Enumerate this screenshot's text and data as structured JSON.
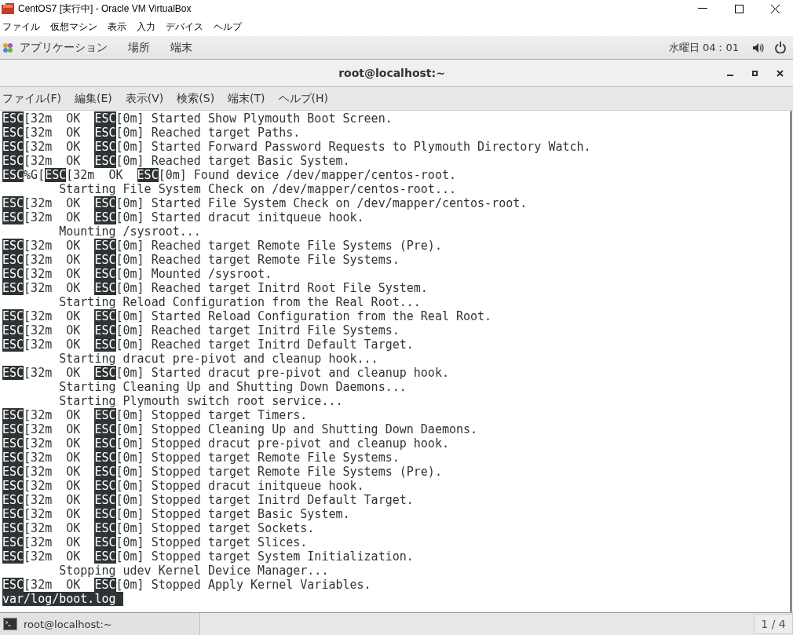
{
  "host_window": {
    "title": "CentOS7 [実行中] - Oracle VM VirtualBox"
  },
  "host_menu": [
    "ファイル",
    "仮想マシン",
    "表示",
    "入力",
    "デバイス",
    "ヘルプ"
  ],
  "top_bar": {
    "menus": [
      "アプリケーション",
      "場所",
      "端末"
    ],
    "clock": "水曜日 04：01"
  },
  "terminal": {
    "title": "root@localhost:~",
    "menu": [
      "ファイル(F)",
      "編集(E)",
      "表示(V)",
      "検索(S)",
      "端末(T)",
      "ヘルプ(H)"
    ],
    "lines": [
      [
        {
          "kind": "inverse",
          "text": "ESC"
        },
        {
          "kind": "plain",
          "text": "[32m  OK  "
        },
        {
          "kind": "inverse",
          "text": "ESC"
        },
        {
          "kind": "plain",
          "text": "[0m] Started Show Plymouth Boot Screen."
        }
      ],
      [
        {
          "kind": "inverse",
          "text": "ESC"
        },
        {
          "kind": "plain",
          "text": "[32m  OK  "
        },
        {
          "kind": "inverse",
          "text": "ESC"
        },
        {
          "kind": "plain",
          "text": "[0m] Reached target Paths."
        }
      ],
      [
        {
          "kind": "inverse",
          "text": "ESC"
        },
        {
          "kind": "plain",
          "text": "[32m  OK  "
        },
        {
          "kind": "inverse",
          "text": "ESC"
        },
        {
          "kind": "plain",
          "text": "[0m] Started Forward Password Requests to Plymouth Directory Watch."
        }
      ],
      [
        {
          "kind": "inverse",
          "text": "ESC"
        },
        {
          "kind": "plain",
          "text": "[32m  OK  "
        },
        {
          "kind": "inverse",
          "text": "ESC"
        },
        {
          "kind": "plain",
          "text": "[0m] Reached target Basic System."
        }
      ],
      [
        {
          "kind": "inverse",
          "text": "ESC"
        },
        {
          "kind": "plain",
          "text": "%G["
        },
        {
          "kind": "inverse",
          "text": "ESC"
        },
        {
          "kind": "plain",
          "text": "[32m  OK  "
        },
        {
          "kind": "inverse",
          "text": "ESC"
        },
        {
          "kind": "plain",
          "text": "[0m] Found device /dev/mapper/centos-root."
        }
      ],
      [
        {
          "kind": "plain",
          "text": "        Starting File System Check on /dev/mapper/centos-root..."
        }
      ],
      [
        {
          "kind": "inverse",
          "text": "ESC"
        },
        {
          "kind": "plain",
          "text": "[32m  OK  "
        },
        {
          "kind": "inverse",
          "text": "ESC"
        },
        {
          "kind": "plain",
          "text": "[0m] Started File System Check on /dev/mapper/centos-root."
        }
      ],
      [
        {
          "kind": "inverse",
          "text": "ESC"
        },
        {
          "kind": "plain",
          "text": "[32m  OK  "
        },
        {
          "kind": "inverse",
          "text": "ESC"
        },
        {
          "kind": "plain",
          "text": "[0m] Started dracut initqueue hook."
        }
      ],
      [
        {
          "kind": "plain",
          "text": "        Mounting /sysroot..."
        }
      ],
      [
        {
          "kind": "inverse",
          "text": "ESC"
        },
        {
          "kind": "plain",
          "text": "[32m  OK  "
        },
        {
          "kind": "inverse",
          "text": "ESC"
        },
        {
          "kind": "plain",
          "text": "[0m] Reached target Remote File Systems (Pre)."
        }
      ],
      [
        {
          "kind": "inverse",
          "text": "ESC"
        },
        {
          "kind": "plain",
          "text": "[32m  OK  "
        },
        {
          "kind": "inverse",
          "text": "ESC"
        },
        {
          "kind": "plain",
          "text": "[0m] Reached target Remote File Systems."
        }
      ],
      [
        {
          "kind": "inverse",
          "text": "ESC"
        },
        {
          "kind": "plain",
          "text": "[32m  OK  "
        },
        {
          "kind": "inverse",
          "text": "ESC"
        },
        {
          "kind": "plain",
          "text": "[0m] Mounted /sysroot."
        }
      ],
      [
        {
          "kind": "inverse",
          "text": "ESC"
        },
        {
          "kind": "plain",
          "text": "[32m  OK  "
        },
        {
          "kind": "inverse",
          "text": "ESC"
        },
        {
          "kind": "plain",
          "text": "[0m] Reached target Initrd Root File System."
        }
      ],
      [
        {
          "kind": "plain",
          "text": "        Starting Reload Configuration from the Real Root..."
        }
      ],
      [
        {
          "kind": "inverse",
          "text": "ESC"
        },
        {
          "kind": "plain",
          "text": "[32m  OK  "
        },
        {
          "kind": "inverse",
          "text": "ESC"
        },
        {
          "kind": "plain",
          "text": "[0m] Started Reload Configuration from the Real Root."
        }
      ],
      [
        {
          "kind": "inverse",
          "text": "ESC"
        },
        {
          "kind": "plain",
          "text": "[32m  OK  "
        },
        {
          "kind": "inverse",
          "text": "ESC"
        },
        {
          "kind": "plain",
          "text": "[0m] Reached target Initrd File Systems."
        }
      ],
      [
        {
          "kind": "inverse",
          "text": "ESC"
        },
        {
          "kind": "plain",
          "text": "[32m  OK  "
        },
        {
          "kind": "inverse",
          "text": "ESC"
        },
        {
          "kind": "plain",
          "text": "[0m] Reached target Initrd Default Target."
        }
      ],
      [
        {
          "kind": "plain",
          "text": "        Starting dracut pre-pivot and cleanup hook..."
        }
      ],
      [
        {
          "kind": "inverse",
          "text": "ESC"
        },
        {
          "kind": "plain",
          "text": "[32m  OK  "
        },
        {
          "kind": "inverse",
          "text": "ESC"
        },
        {
          "kind": "plain",
          "text": "[0m] Started dracut pre-pivot and cleanup hook."
        }
      ],
      [
        {
          "kind": "plain",
          "text": "        Starting Cleaning Up and Shutting Down Daemons..."
        }
      ],
      [
        {
          "kind": "plain",
          "text": "        Starting Plymouth switch root service..."
        }
      ],
      [
        {
          "kind": "inverse",
          "text": "ESC"
        },
        {
          "kind": "plain",
          "text": "[32m  OK  "
        },
        {
          "kind": "inverse",
          "text": "ESC"
        },
        {
          "kind": "plain",
          "text": "[0m] Stopped target Timers."
        }
      ],
      [
        {
          "kind": "inverse",
          "text": "ESC"
        },
        {
          "kind": "plain",
          "text": "[32m  OK  "
        },
        {
          "kind": "inverse",
          "text": "ESC"
        },
        {
          "kind": "plain",
          "text": "[0m] Stopped Cleaning Up and Shutting Down Daemons."
        }
      ],
      [
        {
          "kind": "inverse",
          "text": "ESC"
        },
        {
          "kind": "plain",
          "text": "[32m  OK  "
        },
        {
          "kind": "inverse",
          "text": "ESC"
        },
        {
          "kind": "plain",
          "text": "[0m] Stopped dracut pre-pivot and cleanup hook."
        }
      ],
      [
        {
          "kind": "inverse",
          "text": "ESC"
        },
        {
          "kind": "plain",
          "text": "[32m  OK  "
        },
        {
          "kind": "inverse",
          "text": "ESC"
        },
        {
          "kind": "plain",
          "text": "[0m] Stopped target Remote File Systems."
        }
      ],
      [
        {
          "kind": "inverse",
          "text": "ESC"
        },
        {
          "kind": "plain",
          "text": "[32m  OK  "
        },
        {
          "kind": "inverse",
          "text": "ESC"
        },
        {
          "kind": "plain",
          "text": "[0m] Stopped target Remote File Systems (Pre)."
        }
      ],
      [
        {
          "kind": "inverse",
          "text": "ESC"
        },
        {
          "kind": "plain",
          "text": "[32m  OK  "
        },
        {
          "kind": "inverse",
          "text": "ESC"
        },
        {
          "kind": "plain",
          "text": "[0m] Stopped dracut initqueue hook."
        }
      ],
      [
        {
          "kind": "inverse",
          "text": "ESC"
        },
        {
          "kind": "plain",
          "text": "[32m  OK  "
        },
        {
          "kind": "inverse",
          "text": "ESC"
        },
        {
          "kind": "plain",
          "text": "[0m] Stopped target Initrd Default Target."
        }
      ],
      [
        {
          "kind": "inverse",
          "text": "ESC"
        },
        {
          "kind": "plain",
          "text": "[32m  OK  "
        },
        {
          "kind": "inverse",
          "text": "ESC"
        },
        {
          "kind": "plain",
          "text": "[0m] Stopped target Basic System."
        }
      ],
      [
        {
          "kind": "inverse",
          "text": "ESC"
        },
        {
          "kind": "plain",
          "text": "[32m  OK  "
        },
        {
          "kind": "inverse",
          "text": "ESC"
        },
        {
          "kind": "plain",
          "text": "[0m] Stopped target Sockets."
        }
      ],
      [
        {
          "kind": "inverse",
          "text": "ESC"
        },
        {
          "kind": "plain",
          "text": "[32m  OK  "
        },
        {
          "kind": "inverse",
          "text": "ESC"
        },
        {
          "kind": "plain",
          "text": "[0m] Stopped target Slices."
        }
      ],
      [
        {
          "kind": "inverse",
          "text": "ESC"
        },
        {
          "kind": "plain",
          "text": "[32m  OK  "
        },
        {
          "kind": "inverse",
          "text": "ESC"
        },
        {
          "kind": "plain",
          "text": "[0m] Stopped target System Initialization."
        }
      ],
      [
        {
          "kind": "plain",
          "text": "        Stopping udev Kernel Device Manager..."
        }
      ],
      [
        {
          "kind": "inverse",
          "text": "ESC"
        },
        {
          "kind": "plain",
          "text": "[32m  OK  "
        },
        {
          "kind": "inverse",
          "text": "ESC"
        },
        {
          "kind": "plain",
          "text": "[0m] Stopped Apply Kernel Variables."
        }
      ],
      [
        {
          "kind": "inverse",
          "text": "var/log/boot.log "
        }
      ]
    ]
  },
  "taskbar": {
    "windows": [
      {
        "title": "root@localhost:~",
        "selected": false
      }
    ],
    "workspace": "1 / 4"
  }
}
